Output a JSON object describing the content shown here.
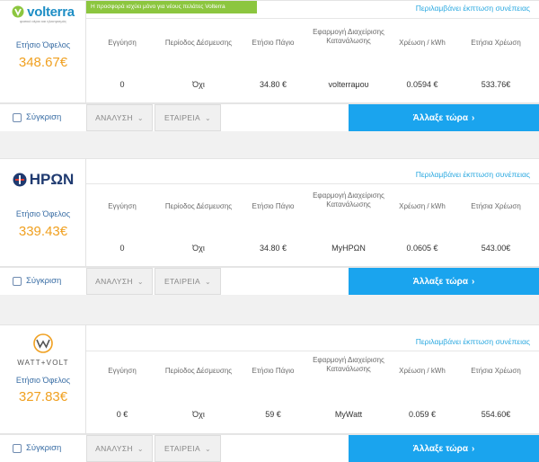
{
  "columns": [
    "Εγγύηση",
    "Περίοδος Δέσμευσης",
    "Ετήσιο Πάγιο",
    "Εφαρμογή Διαχείρισης Κατανάλωσης",
    "Χρέωση / kWh",
    "Ετήσια Χρέωση"
  ],
  "colors": {
    "accent_blue": "#1aa4ee",
    "benefit_orange": "#f0a020",
    "promo_green": "#8cc63f",
    "link_blue": "#29a8e0"
  },
  "cards": [
    {
      "provider": "volterra",
      "logo_text": "volterra",
      "logo_tagline": "φυσικό αέριο και ηλεκτρισμός",
      "promo_text": "Η προσφορά ισχύει μόνο για νέους πελάτες Volterra",
      "discount_note": "Περιλαμβάνει έκπτωση συνέπειας",
      "benefit_label": "Ετήσιο Όφελος",
      "benefit_value": "348.67€",
      "values": [
        "0",
        "Όχι",
        "34.80 €",
        "volterraμου",
        "0.0594 €",
        "533.76€"
      ]
    },
    {
      "provider": "heron",
      "logo_text": "ΗΡΩΝ",
      "discount_note": "Περιλαμβάνει έκπτωση συνέπειας",
      "benefit_label": "Ετήσιο Όφελος",
      "benefit_value": "339.43€",
      "values": [
        "0",
        "Όχι",
        "34.80 €",
        "MyΗΡΩΝ",
        "0.0605 €",
        "543.00€"
      ]
    },
    {
      "provider": "watt-volt",
      "logo_text": "WATT+VOLT",
      "discount_note": "Περιλαμβάνει έκπτωση συνέπειας",
      "benefit_label": "Ετήσιο Όφελος",
      "benefit_value": "327.83€",
      "values": [
        "0 €",
        "Όχι",
        "59 €",
        "MyWatt",
        "0.059 €",
        "554.60€"
      ]
    }
  ],
  "footer": {
    "compare_label": "Σύγκριση",
    "analysis_label": "ΑΝΑΛΥΣΗ",
    "company_label": "ΕΤΑΙΡΕΙΑ",
    "cta_label": "Άλλαξε τώρα"
  }
}
